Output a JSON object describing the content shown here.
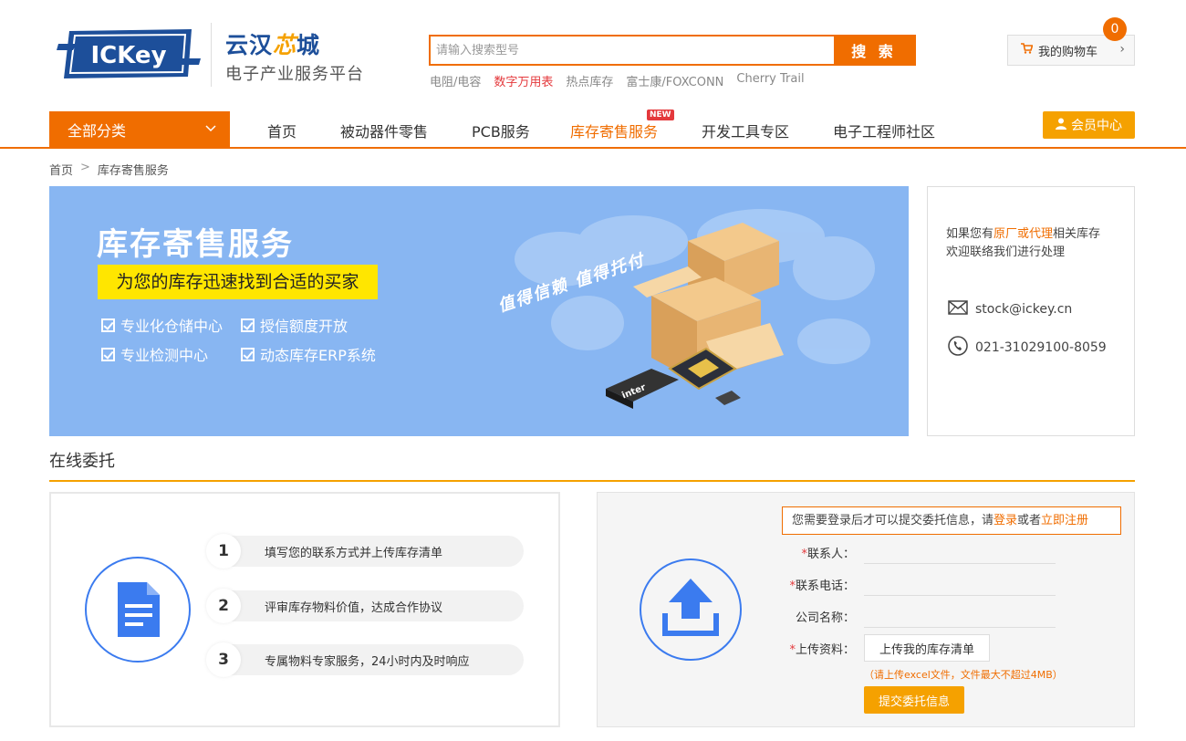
{
  "header": {
    "logo_text": "ICKey",
    "brand_name_a": "云汉",
    "brand_name_b": "芯",
    "brand_name_c": "城",
    "slogan": "电子产业服务平台",
    "search_placeholder": "请输入搜索型号",
    "search_button": "搜 索",
    "hot_links": [
      "电阻/电容",
      "数字万用表",
      "热点库存",
      "富士康/FOXCONN",
      "Cherry Trail"
    ],
    "cart_label": "我的购物车",
    "cart_count": "0"
  },
  "nav": {
    "categories_label": "全部分类",
    "items": [
      "首页",
      "被动器件零售",
      "PCB服务",
      "库存寄售服务",
      "开发工具专区",
      "电子工程师社区"
    ],
    "new_badge": "NEW",
    "member_center": "会员中心"
  },
  "breadcrumb": [
    "首页",
    ">",
    "库存寄售服务"
  ],
  "banner": {
    "title": "库存寄售服务",
    "subtitle": "为您的库存迅速找到合适的买家",
    "features": [
      "专业化仓储中心",
      "授信额度开放",
      "专业检测中心",
      "动态库存ERP系统"
    ],
    "trust_slogan": "值得信赖 值得托付",
    "chip_brand": "inter"
  },
  "contact": {
    "line1_prefix": "如果您有",
    "line1_highlight": "原厂或代理",
    "line1_suffix": "相关库存",
    "line2": "欢迎联络我们进行处理",
    "email": "stock@ickey.cn",
    "phone": "021-31029100-8059"
  },
  "section": {
    "title": "在线委托"
  },
  "steps": [
    {
      "num": "1",
      "text": "填写您的联系方式并上传库存清单"
    },
    {
      "num": "2",
      "text": "评审库存物料价值，达成合作协议"
    },
    {
      "num": "3",
      "text": "专属物料专家服务，24小时内及时响应"
    }
  ],
  "form": {
    "notice_prefix": "您需要登录后才可以提交委托信息，请",
    "notice_login": "登录",
    "notice_mid": "或者",
    "notice_register": "立即注册",
    "required_mark": "*",
    "contact_label": "联系人：",
    "phone_label": "联系电话：",
    "company_label": "公司名称：",
    "upload_label": "上传资料：",
    "upload_button": "上传我的库存清单",
    "upload_hint": "（请上传excel文件，文件最大不超过4MB）",
    "submit_button": "提交委托信息"
  },
  "colors": {
    "brand_orange": "#f06d00",
    "brand_blue": "#1d4f9a",
    "icon_blue": "#3b7bef",
    "banner_bg": "#88b6f2"
  }
}
